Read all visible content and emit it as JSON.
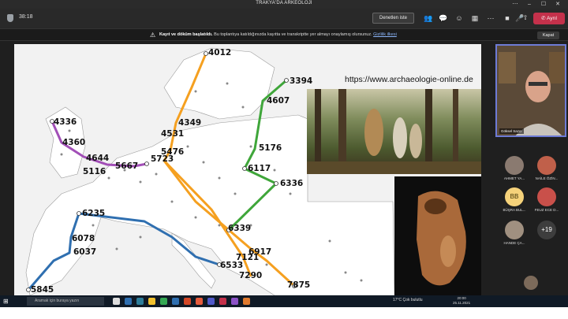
{
  "window": {
    "title": "TRAKYA'DA ARKEOLOJİ"
  },
  "toolbar": {
    "timer": "38:18",
    "meeting_notes_label": "Denetlen iste",
    "leave_label": "Ayrıl"
  },
  "banner": {
    "bold": "Kayıt ve döküm başlatıldı.",
    "text": "Bu toplantıya katıldığınızda kayıtta ve transkriptte yer almayı onaylamış olursunuz.",
    "link": "Gizlilik ilkesi",
    "close_label": "Kapat"
  },
  "slide": {
    "url": "https://www.archaeologie-online.de",
    "routes": {
      "orange": "#f5a020",
      "green": "#3fa63a",
      "purple": "#a24fb7",
      "blue": "#2f6fb0"
    },
    "labels": {
      "l4012": "4012",
      "l3394": "3394",
      "l4607": "4607",
      "l4336": "4336",
      "l4349": "4349",
      "l4360": "4360",
      "l4531": "4531",
      "l5476": "5476",
      "l5176": "5176",
      "l4644": "4644",
      "l5723": "5723",
      "l5667": "5667",
      "l5116": "5116",
      "l6117": "6117",
      "l6336": "6336",
      "l6235": "6235",
      "l6339": "6339",
      "l6078": "6078",
      "l6037": "6037",
      "l6917": "6917",
      "l7121": "7121",
      "l6533": "6533",
      "l7290": "7290",
      "l7875": "7875",
      "l5845": "5845"
    }
  },
  "presenter": {
    "name": "Göksel Sazcı"
  },
  "participants": [
    {
      "name": "AHMET YA...",
      "initials": ""
    },
    {
      "name": "NAİLE ÖZİN...",
      "initials": ""
    },
    {
      "name": "BÜŞRA BUL...",
      "initials": "BB"
    },
    {
      "name": "FEUZ ECE D...",
      "initials": ""
    },
    {
      "name": "HANDE ÇA...",
      "initials": ""
    },
    {
      "name": "",
      "initials": "+19"
    }
  ],
  "taskbar": {
    "search_placeholder": "Aramak için buraya yazın",
    "weather": "17°C Çok bulutlu",
    "time": "20:00",
    "date": "25.11.2021",
    "self_name": "Göksel Sazcı"
  }
}
